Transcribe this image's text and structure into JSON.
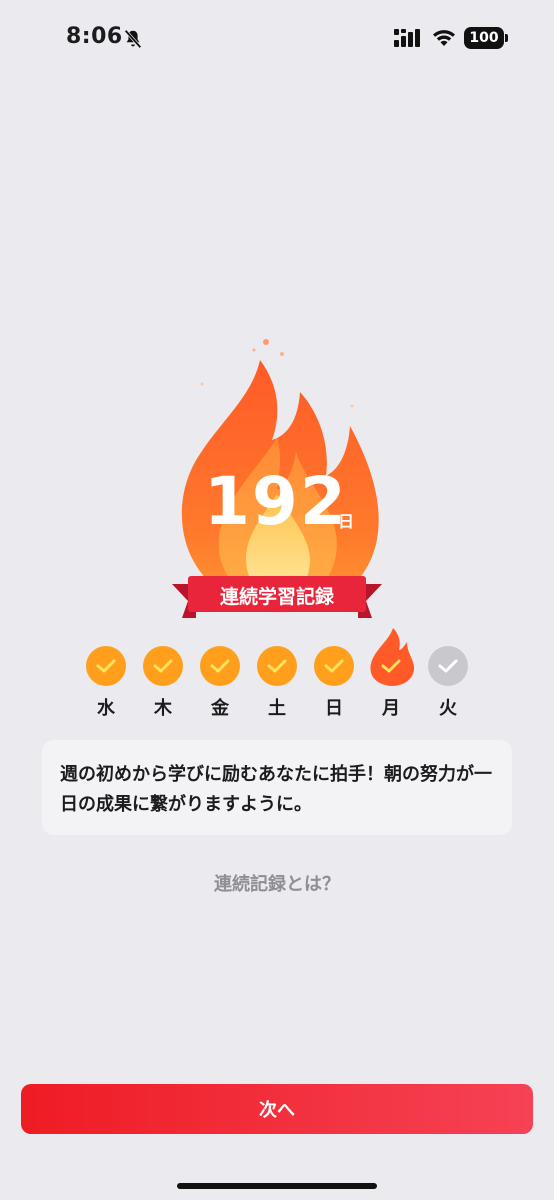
{
  "status_bar": {
    "time": "8:06",
    "battery": "100",
    "icons": [
      "bell-slash-icon",
      "signal-icon",
      "wifi-icon",
      "battery-icon"
    ]
  },
  "streak": {
    "count": "192",
    "unit": "日",
    "ribbon_label": "連続学習記録",
    "flame_color": "#FF6A2B",
    "ribbon_color": "#E8253A"
  },
  "week": {
    "days": [
      {
        "label": "水",
        "state": "done"
      },
      {
        "label": "木",
        "state": "done"
      },
      {
        "label": "金",
        "state": "done"
      },
      {
        "label": "土",
        "state": "done"
      },
      {
        "label": "日",
        "state": "done"
      },
      {
        "label": "月",
        "state": "today"
      },
      {
        "label": "火",
        "state": "todo"
      }
    ],
    "done_color": "#FF9F1C",
    "todo_color": "#C8C8CE"
  },
  "message": {
    "text": "週の初めから学びに励むあなたに拍手！朝の努力が一日の成果に繋がりますように。"
  },
  "help_link": "連続記録とは？",
  "next_button": "次へ",
  "accent_color": "#EE1C24"
}
